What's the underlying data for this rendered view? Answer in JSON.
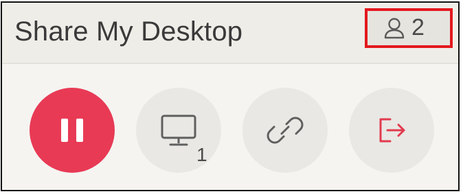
{
  "window": {
    "title": "Share My Desktop",
    "participants": {
      "icon": "person-icon",
      "count": "2",
      "highlight_color": "#e3191e"
    }
  },
  "toolbar": {
    "buttons": [
      {
        "name": "pause",
        "icon": "pause-icon",
        "color": "#e83a55"
      },
      {
        "name": "select-screen",
        "icon": "monitor-icon",
        "badge": "1"
      },
      {
        "name": "share-link",
        "icon": "link-icon"
      },
      {
        "name": "leave",
        "icon": "exit-icon",
        "color": "#e83a55"
      }
    ]
  }
}
